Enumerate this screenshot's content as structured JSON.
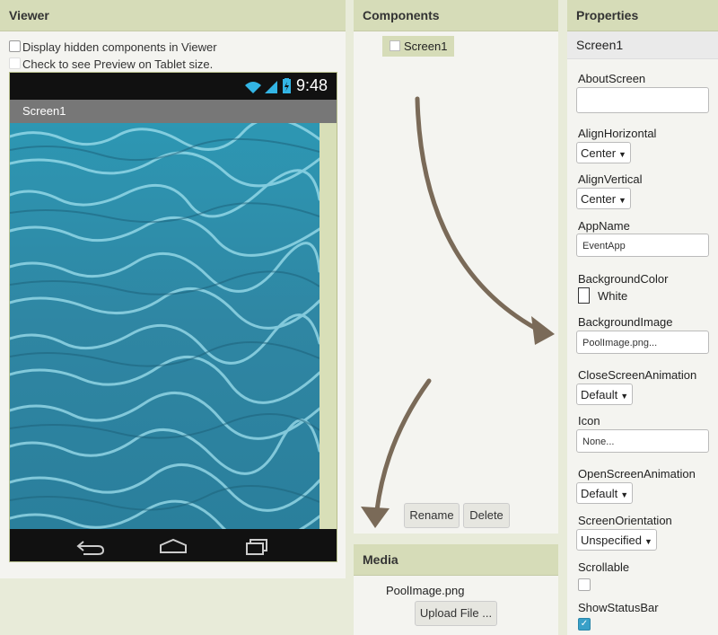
{
  "viewer": {
    "header": "Viewer",
    "hidden_components_label": "Display hidden components in Viewer",
    "tablet_preview_label": "Check to see Preview on Tablet size.",
    "phone": {
      "time": "9:48",
      "screen_title": "Screen1"
    }
  },
  "components": {
    "header": "Components",
    "tree_root": "Screen1",
    "rename_label": "Rename",
    "delete_label": "Delete"
  },
  "media": {
    "header": "Media",
    "file": "PoolImage.png",
    "upload_label": "Upload File ..."
  },
  "properties": {
    "header": "Properties",
    "component_name": "Screen1",
    "about_screen_label": "AboutScreen",
    "about_screen_value": "",
    "align_horizontal_label": "AlignHorizontal",
    "align_horizontal_value": "Center",
    "align_vertical_label": "AlignVertical",
    "align_vertical_value": "Center",
    "app_name_label": "AppName",
    "app_name_value": "EventApp",
    "background_color_label": "BackgroundColor",
    "background_color_value": "White",
    "background_image_label": "BackgroundImage",
    "background_image_value": "PoolImage.png...",
    "close_animation_label": "CloseScreenAnimation",
    "close_animation_value": "Default",
    "icon_label": "Icon",
    "icon_value": "None...",
    "open_animation_label": "OpenScreenAnimation",
    "open_animation_value": "Default",
    "orientation_label": "ScreenOrientation",
    "orientation_value": "Unspecified",
    "scrollable_label": "Scrollable",
    "scrollable_checked": false,
    "show_status_bar_label": "ShowStatusBar",
    "show_status_bar_checked": true
  },
  "colors": {
    "header_bg": "#d6dcb8",
    "page_bg": "#e8ebd9",
    "water": "#2f8aa6",
    "arrow": "#7a6a58",
    "checkbox_on": "#39a0c8"
  },
  "icons": [
    "wifi-icon",
    "signal-icon",
    "battery-icon",
    "back-icon",
    "home-icon",
    "recent-apps-icon",
    "caret-down-icon",
    "checkmark-icon"
  ]
}
